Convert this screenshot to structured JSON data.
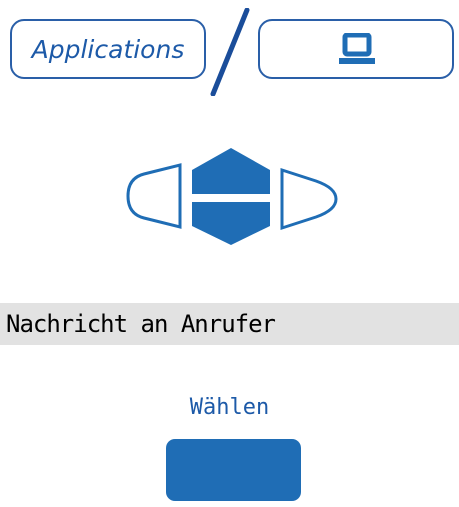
{
  "header": {
    "applications_label": "Applications",
    "screen_icon": "desktop-computer-icon"
  },
  "display": {
    "message": "Nachricht an Anrufer"
  },
  "softkey": {
    "label": "Wählen"
  },
  "colors": {
    "accent": "#1f6db5",
    "outline": "#2a5fa8",
    "display_bg": "#e2e2e2"
  }
}
